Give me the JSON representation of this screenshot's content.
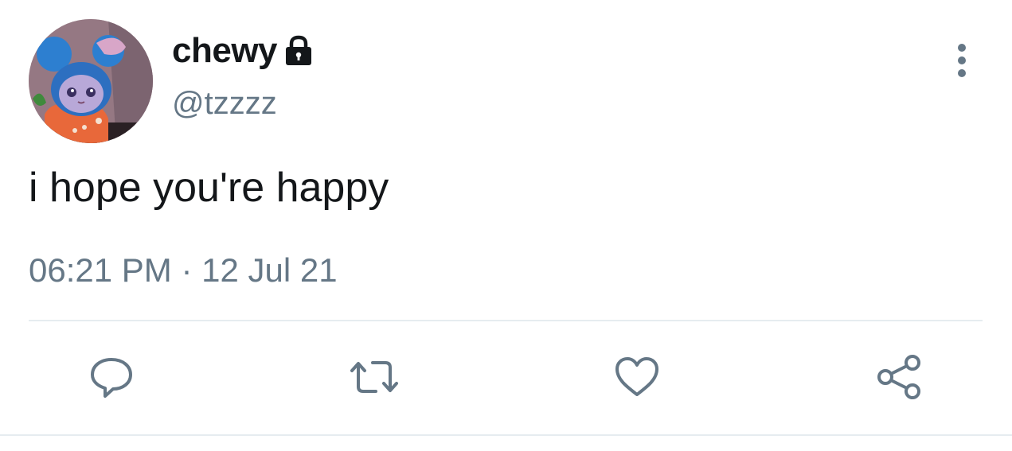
{
  "tweet": {
    "display_name": "chewy",
    "handle": "@tzzzz",
    "text": "i hope you're happy",
    "timestamp": "06:21 PM · 12 Jul 21",
    "protected": true
  },
  "icons": {
    "lock": "lock-icon",
    "more": "more-vertical-icon",
    "reply": "reply-icon",
    "retweet": "retweet-icon",
    "like": "heart-icon",
    "share": "share-icon"
  },
  "colors": {
    "text_primary": "#14171a",
    "text_secondary": "#657786",
    "divider": "#e6ecf0"
  }
}
